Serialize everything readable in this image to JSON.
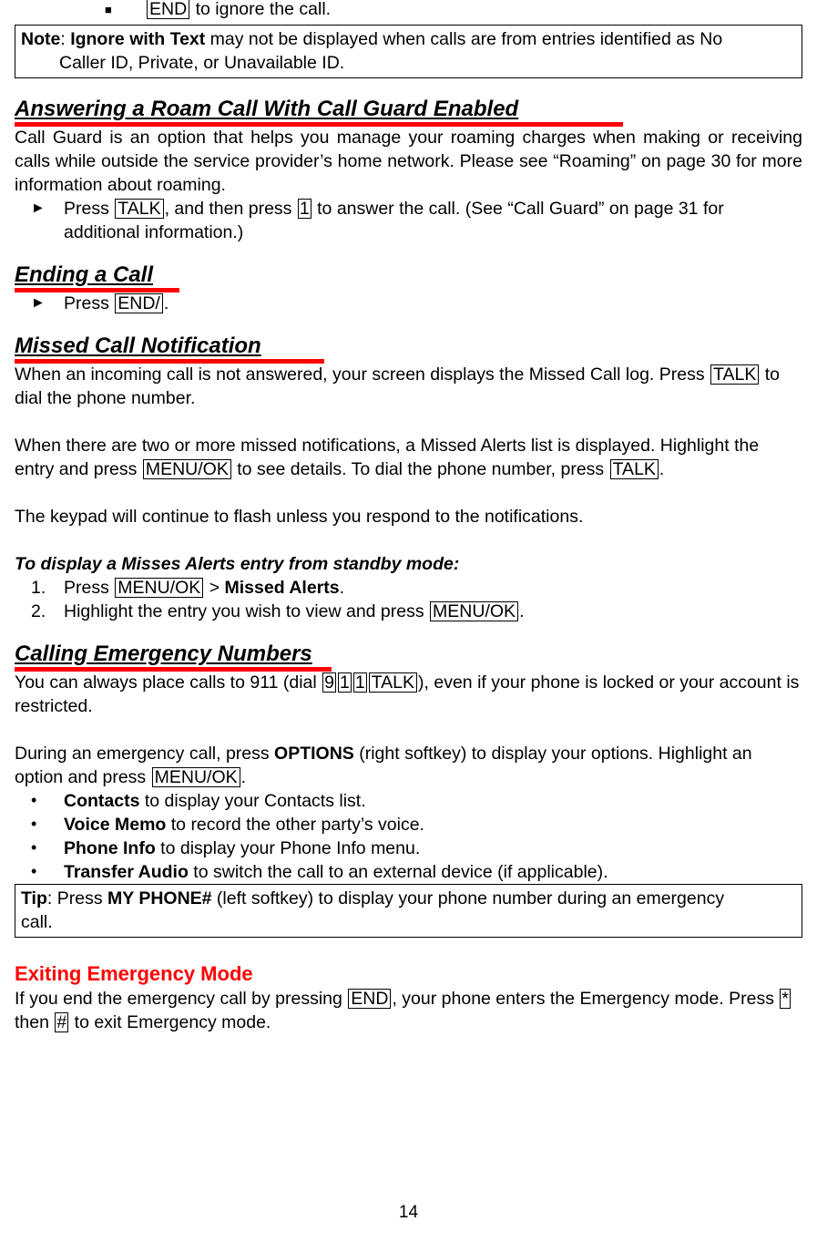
{
  "document": {
    "page_number": "14",
    "accent_red": "#ff0000"
  },
  "top_bullet": {
    "marker": "■",
    "key": "END",
    "text": " to ignore the call."
  },
  "note_box": {
    "label": "Note",
    "colon": ": ",
    "bold_term": "Ignore with Text",
    "line1_rest": " may not be displayed when calls are from entries identified as No",
    "line2": "Caller ID, Private, or Unavailable ID."
  },
  "roam_section": {
    "heading": "Answering a Roam Call With Call Guard Enabled",
    "paragraph": "Call Guard is an option that helps you manage your roaming charges when making or receiving calls while outside the service provider’s home network. Please see “Roaming” on page 30 for more information about roaming.",
    "step_marker": "►",
    "step_prefix": "Press ",
    "step_key1": "TALK",
    "step_mid": ", and then press ",
    "step_key2": "1",
    "step_suffix": " to answer the call. (See “Call Guard” on page 31 for additional information.)"
  },
  "ending_section": {
    "heading": "Ending a Call",
    "step_marker": "►",
    "step_prefix": "Press ",
    "step_key": "END/",
    "step_suffix": "."
  },
  "missed_section": {
    "heading": "Missed Call Notification",
    "p1_a": "When an incoming call is not answered, your screen displays the Missed Call log. Press ",
    "p1_key": "TALK",
    "p1_b": " to dial the phone number.",
    "p2_a": "When there are two or more missed notifications, a Missed Alerts list is displayed. Highlight the entry and press ",
    "p2_key1": "MENU/OK",
    "p2_b": " to see details. To dial the phone number, press ",
    "p2_key2": "TALK",
    "p2_c": ".",
    "p3": "The keypad will continue to flash unless you respond to the notifications.",
    "sub_heading": "To display a Misses Alerts entry from standby mode:",
    "steps": [
      {
        "number": "1.",
        "prefix": "Press ",
        "key": "MENU/OK",
        "mid": " > ",
        "bold": "Missed Alerts",
        "suffix": "."
      },
      {
        "number": "2.",
        "prefix": "Highlight the entry you wish to view and press ",
        "key": "MENU/OK",
        "mid": "",
        "bold": "",
        "suffix": "."
      }
    ]
  },
  "emergency_section": {
    "heading": "Calling Emergency Numbers",
    "p1_a": "You can always place calls to 911 (dial ",
    "p1_key1": "9",
    "p1_key2": "1",
    "p1_key3": "1",
    "p1_key4": "TALK",
    "p1_b": "), even if your phone is locked or your account is restricted.",
    "p2_a": "During an emergency call, press ",
    "p2_bold": "OPTIONS",
    "p2_b": " (right softkey) to display your options. Highlight an option and press ",
    "p2_key": "MENU/OK",
    "p2_c": ".",
    "options": [
      {
        "marker": "•",
        "bold": "Contacts",
        "text": " to display your Contacts list."
      },
      {
        "marker": "•",
        "bold": "Voice Memo",
        "text": " to record the other party’s voice."
      },
      {
        "marker": "•",
        "bold": "Phone Info",
        "text": " to display your Phone Info menu."
      },
      {
        "marker": "•",
        "bold": "Transfer Audio",
        "text": " to switch the call to an external device (if applicable)."
      }
    ]
  },
  "tip_box": {
    "label": "Tip",
    "colon": ": Press ",
    "bold_term": "MY PHONE#",
    "line1_rest": " (left softkey) to display your phone number during an emergency",
    "line2": "call."
  },
  "exiting_section": {
    "heading": "Exiting Emergency Mode",
    "p1_a": "If you end the emergency call by pressing ",
    "p1_key": "END",
    "p1_b": ", your phone enters the Emergency mode. Press ",
    "p1_key2": "*",
    "p1_c": " then ",
    "p1_key3": "#",
    "p1_d": " to exit Emergency mode."
  }
}
